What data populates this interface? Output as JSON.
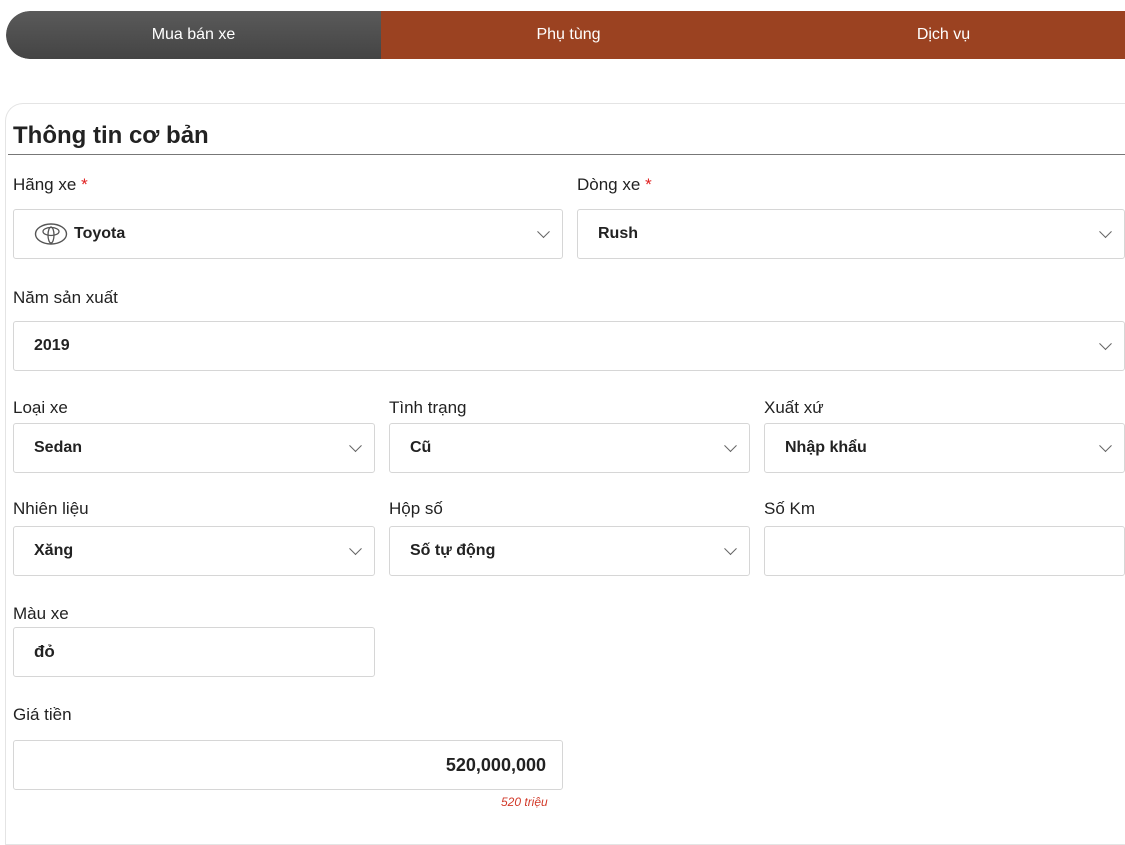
{
  "tabs": [
    {
      "label": "Mua bán xe",
      "active": true
    },
    {
      "label": "Phụ tùng",
      "active": false
    },
    {
      "label": "Dịch vụ",
      "active": false
    }
  ],
  "section": {
    "title": "Thông tin cơ bản"
  },
  "fields": {
    "brand": {
      "label": "Hãng xe",
      "required_mark": "*",
      "value": "Toyota",
      "icon": "toyota-logo-icon"
    },
    "model": {
      "label": "Dòng xe",
      "required_mark": "*",
      "value": "Rush"
    },
    "year": {
      "label": "Năm sản xuất",
      "value": "2019"
    },
    "body_type": {
      "label": "Loại xe",
      "value": "Sedan"
    },
    "condition": {
      "label": "Tình trạng",
      "value": "Cũ"
    },
    "origin": {
      "label": "Xuất xứ",
      "value": "Nhập khẩu"
    },
    "fuel": {
      "label": "Nhiên liệu",
      "value": "Xăng"
    },
    "gearbox": {
      "label": "Hộp số",
      "value": "Số tự động"
    },
    "mileage": {
      "label": "Số Km",
      "value": ""
    },
    "color": {
      "label": "Màu xe",
      "value": "đỏ"
    },
    "price": {
      "label": "Giá tiền",
      "value": "520,000,000",
      "hint": "520 triệu"
    }
  },
  "colors": {
    "active_tab": "#4f4f4f",
    "tab": "#9b4221",
    "required": "#e02020",
    "hint": "#d23a2a"
  }
}
